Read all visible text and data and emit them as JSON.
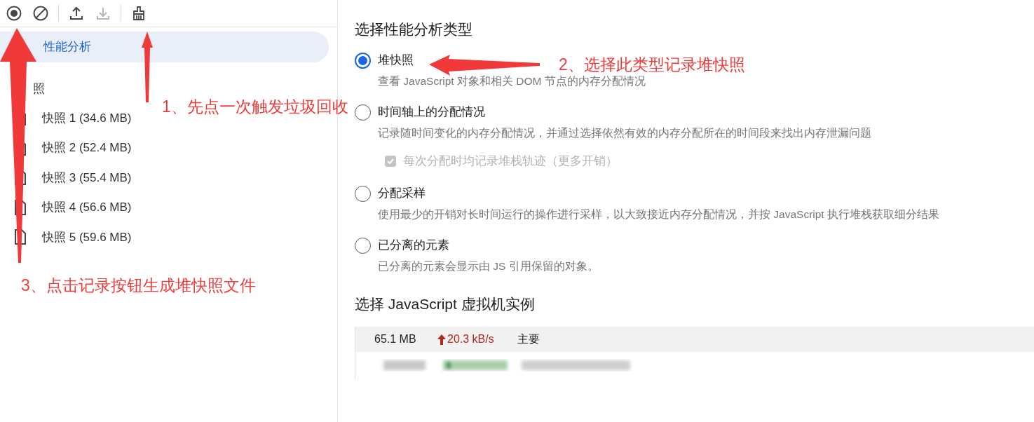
{
  "toolbar": {
    "buttons": [
      {
        "kind": "record",
        "disabled": false
      },
      {
        "kind": "clear",
        "disabled": false
      },
      {
        "kind": "separator"
      },
      {
        "kind": "upload",
        "disabled": false
      },
      {
        "kind": "download",
        "disabled": true
      },
      {
        "kind": "separator"
      },
      {
        "kind": "gc",
        "disabled": false
      }
    ]
  },
  "sidebar": {
    "profiles_item": {
      "label": "性能分析",
      "selected": true
    },
    "section_title": "照",
    "snapshots": [
      {
        "label": "快照 1 (34.6 MB)"
      },
      {
        "label": "快照 2 (52.4 MB)"
      },
      {
        "label": "快照 3 (55.4 MB)"
      },
      {
        "label": "快照 4 (56.6 MB)"
      },
      {
        "label": "快照 5 (59.6 MB)"
      }
    ]
  },
  "profile_types": {
    "title": "选择性能分析类型",
    "options": [
      {
        "label": "堆快照",
        "description": "查看 JavaScript 对象和相关 DOM 节点的内存分配情况",
        "selected": true
      },
      {
        "label": "时间轴上的分配情况",
        "description": "记录随时间变化的内存分配情况，并通过选择依然有效的内存分配所在的时间段来找出内存泄漏问题",
        "selected": false,
        "checkbox": {
          "label": "每次分配时均记录堆栈轨迹（更多开销）",
          "checked": true,
          "disabled": true
        }
      },
      {
        "label": "分配采样",
        "description": "使用最少的开销对长时间运行的操作进行采样，以大致接近内存分配情况，并按 JavaScript 执行堆栈获取细分结果",
        "selected": false
      },
      {
        "label": "已分离的元素",
        "description": "已分离的元素会显示由 JS 引用保留的对象。",
        "selected": false
      }
    ]
  },
  "vm_instances": {
    "title": "选择 JavaScript 虚拟机实例",
    "rows": [
      {
        "kind": "instance",
        "memory": "65.1 MB",
        "rate": "20.3 kB/s",
        "name": "主要",
        "selected": true
      },
      {
        "kind": "picture"
      }
    ]
  },
  "annotations": [
    {
      "text": "1、先点一次触发垃圾回收"
    },
    {
      "text": "2、选择此类型记录堆快照"
    },
    {
      "text": "3、点击记录按钮生成堆快照文件"
    }
  ]
}
